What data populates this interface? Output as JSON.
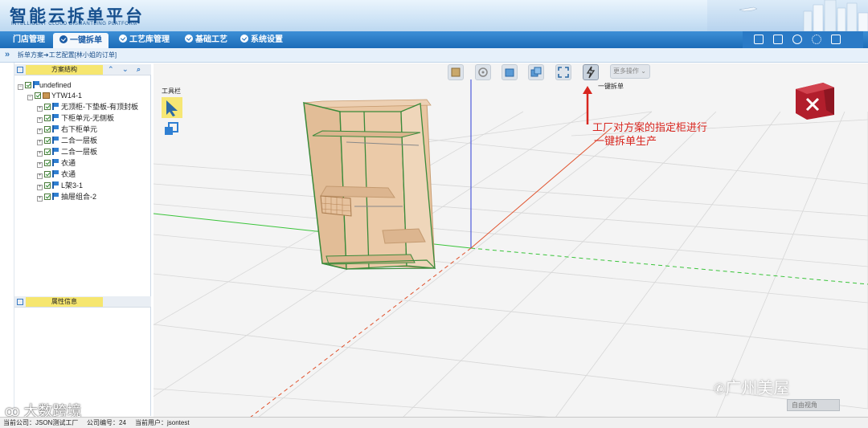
{
  "header": {
    "title": "智能云拆单平台",
    "subtitle": "INTELLIGENT CLOUD DISMANTLING PLATFORM"
  },
  "nav": {
    "items": [
      {
        "label": "门店管理",
        "active": false
      },
      {
        "label": "一键拆单",
        "active": true
      },
      {
        "label": "工艺库管理",
        "active": false
      },
      {
        "label": "基础工艺",
        "active": false
      },
      {
        "label": "系统设置",
        "active": false
      }
    ],
    "right_icons": [
      "home-icon",
      "calculator-icon",
      "users-icon",
      "settings-icon",
      "logout-icon"
    ]
  },
  "breadcrumb": "拆单方案➔工艺配置[林小姐的订单]",
  "left_panel": {
    "structure_title": "方案结构",
    "attributes_title": "属性信息",
    "tree": {
      "root": "undefined",
      "model": "YTW14-1",
      "children": [
        "无顶柜-下垫板-有顶封板",
        "下柜单元-无侧板",
        "右下柜单元",
        "二合一层板",
        "二合一层板",
        "衣通",
        "衣通",
        "L架3-1",
        "抽屉组合-2"
      ]
    }
  },
  "viewport": {
    "toolbar_label": "工具栏",
    "more_ops": "更多操作",
    "one_key_label": "一键拆单",
    "annotation_line1": "工厂对方案的指定柜进行",
    "annotation_line2": "一键拆单生产",
    "free_view": "自由视角",
    "toolbar_icons": [
      "save-icon",
      "target-icon",
      "cube-icon",
      "copy-icon",
      "fullscreen-icon",
      "lightning-icon"
    ],
    "accent_color": "#d8261f"
  },
  "watermarks": {
    "wechat": "广州美屋",
    "dashuju": "大数跨境"
  },
  "footer": {
    "company": "当前公司：JSON测试工厂",
    "company_no": "公司编号：24",
    "user": "当前用户：jsontest"
  }
}
